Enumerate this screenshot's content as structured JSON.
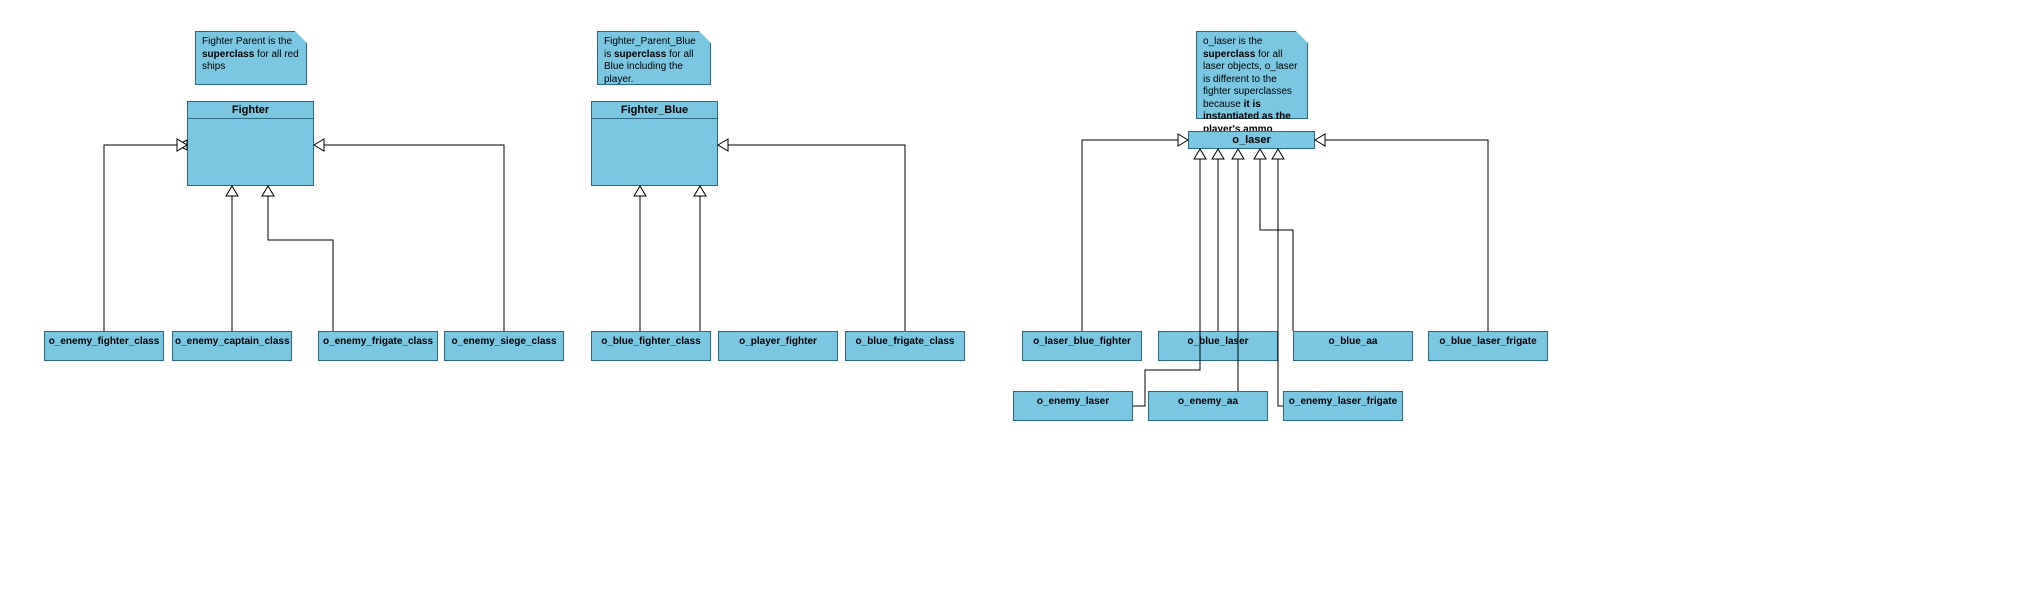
{
  "notes": {
    "fighter_note_pre": "Fighter Parent is the ",
    "fighter_note_bold": "superclass",
    "fighter_note_post": " for all red ships",
    "fighter_blue_note_pre": "Fighter_Parent_Blue is ",
    "fighter_blue_note_bold": "superclass",
    "fighter_blue_note_post": " for all Blue including the player.",
    "laser_note_pre": "o_laser is the ",
    "laser_note_bold1": "superclass",
    "laser_note_mid": " for all laser objects, o_laser is different to the fighter superclasses because ",
    "laser_note_bold2": "it is instantiated as the player's ammo",
    "laser_note_post": "."
  },
  "classes": {
    "fighter": "Fighter",
    "fighter_blue": "Fighter_Blue",
    "o_laser": "o_laser"
  },
  "subclasses": {
    "o_enemy_fighter_class": "o_enemy_fighter_class",
    "o_enemy_captain_class": "o_enemy_captain_class",
    "o_enemy_frigate_class": "o_enemy_frigate_class",
    "o_enemy_siege_class": "o_enemy_siege_class",
    "o_blue_fighter_class": "o_blue_fighter_class",
    "o_player_fighter": "o_player_fighter",
    "o_blue_frigate_class": "o_blue_frigate_class",
    "o_laser_blue_fighter": "o_laser_blue_fighter",
    "o_blue_laser": "o_blue_laser",
    "o_blue_aa": "o_blue_aa",
    "o_blue_laser_frigate": "o_blue_laser_frigate",
    "o_enemy_laser": "o_enemy_laser",
    "o_enemy_aa": "o_enemy_aa",
    "o_enemy_laser_frigate": "o_enemy_laser_frigate"
  },
  "chart_data": {
    "type": "diagram",
    "hierarchies": [
      {
        "superclass": "Fighter",
        "note": "Fighter Parent is the superclass for all red ships",
        "subclasses": [
          "o_enemy_fighter_class",
          "o_enemy_captain_class",
          "o_enemy_frigate_class",
          "o_enemy_siege_class"
        ]
      },
      {
        "superclass": "Fighter_Blue",
        "note": "Fighter_Parent_Blue is superclass for all Blue including the player.",
        "subclasses": [
          "o_blue_fighter_class",
          "o_player_fighter",
          "o_blue_frigate_class"
        ]
      },
      {
        "superclass": "o_laser",
        "note": "o_laser is the superclass for all laser objects, o_laser is different to the fighter superclasses because it is instantiated as the player's ammo.",
        "subclasses": [
          "o_laser_blue_fighter",
          "o_blue_laser",
          "o_blue_aa",
          "o_blue_laser_frigate",
          "o_enemy_laser",
          "o_enemy_aa",
          "o_enemy_laser_frigate"
        ]
      }
    ]
  }
}
